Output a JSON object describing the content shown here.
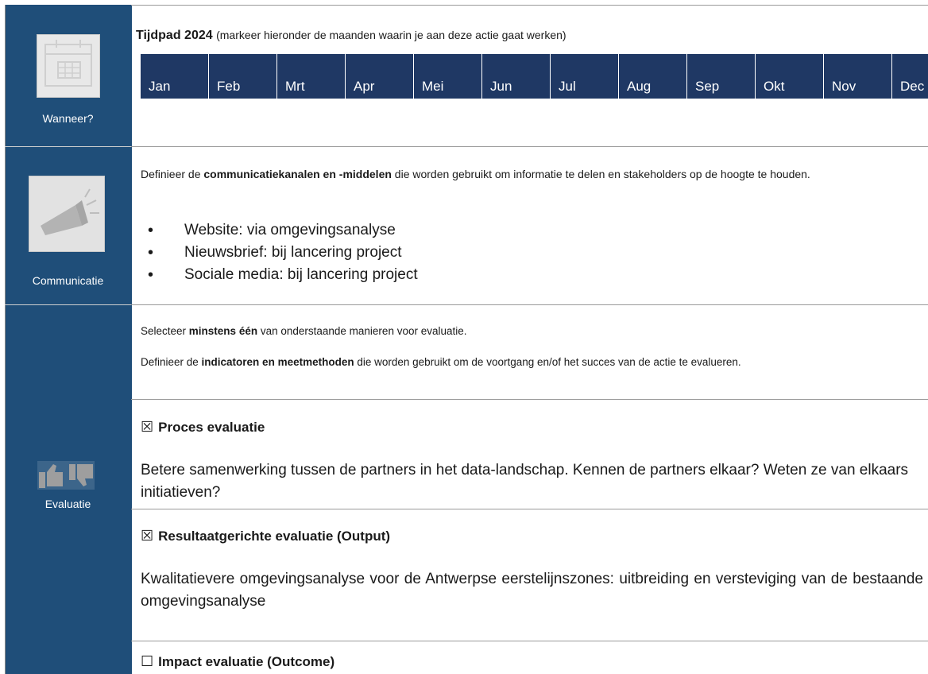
{
  "sidebar": {
    "when_label": "Wanneer?",
    "communication_label": "Communicatie",
    "evaluation_label": "Evaluatie"
  },
  "timeline": {
    "title": "Tijdpad 2024",
    "hint": "(markeer hieronder de maanden waarin je aan deze actie gaat werken)",
    "months": [
      "Jan",
      "Feb",
      "Mrt",
      "Apr",
      "Mei",
      "Jun",
      "Jul",
      "Aug",
      "Sep",
      "Okt",
      "Nov",
      "Dec"
    ],
    "month_color": "#1f3864"
  },
  "communication": {
    "intro_pre": "Definieer de ",
    "intro_bold": "communicatiekanalen en -middelen",
    "intro_post": " die worden gebruikt om informatie te delen en stakeholders op de hoogte te houden.",
    "items": [
      "Website: via omgevingsanalyse",
      "Nieuwsbrief: bij lancering project",
      "Sociale media: bij lancering project"
    ]
  },
  "evaluation": {
    "select_pre": "Selecteer ",
    "select_bold": "minstens één",
    "select_post": " van onderstaande manieren voor evaluatie.",
    "define_pre": "Definieer de ",
    "define_bold": "indicatoren en meetmethoden",
    "define_post": " die worden gebruikt om de voortgang en/of het succes van de actie te evalueren.",
    "process": {
      "checkbox": "☒",
      "title": "Proces evaluatie",
      "text": "Betere samenwerking tussen de partners in het data-landschap. Kennen de partners elkaar? Weten ze van elkaars initiatieven?"
    },
    "output": {
      "checkbox": "☒",
      "title": "Resultaatgerichte evaluatie (Output)",
      "text": "Kwalitatievere omgevingsanalyse voor de Antwerpse eerstelijnszones: uitbreiding en versteviging van de bestaande omgevingsanalyse"
    },
    "impact": {
      "checkbox": "☐",
      "title": "Impact evaluatie (Outcome)"
    }
  },
  "colors": {
    "sidebar": "#1f4e79",
    "month_header": "#1f3864"
  }
}
